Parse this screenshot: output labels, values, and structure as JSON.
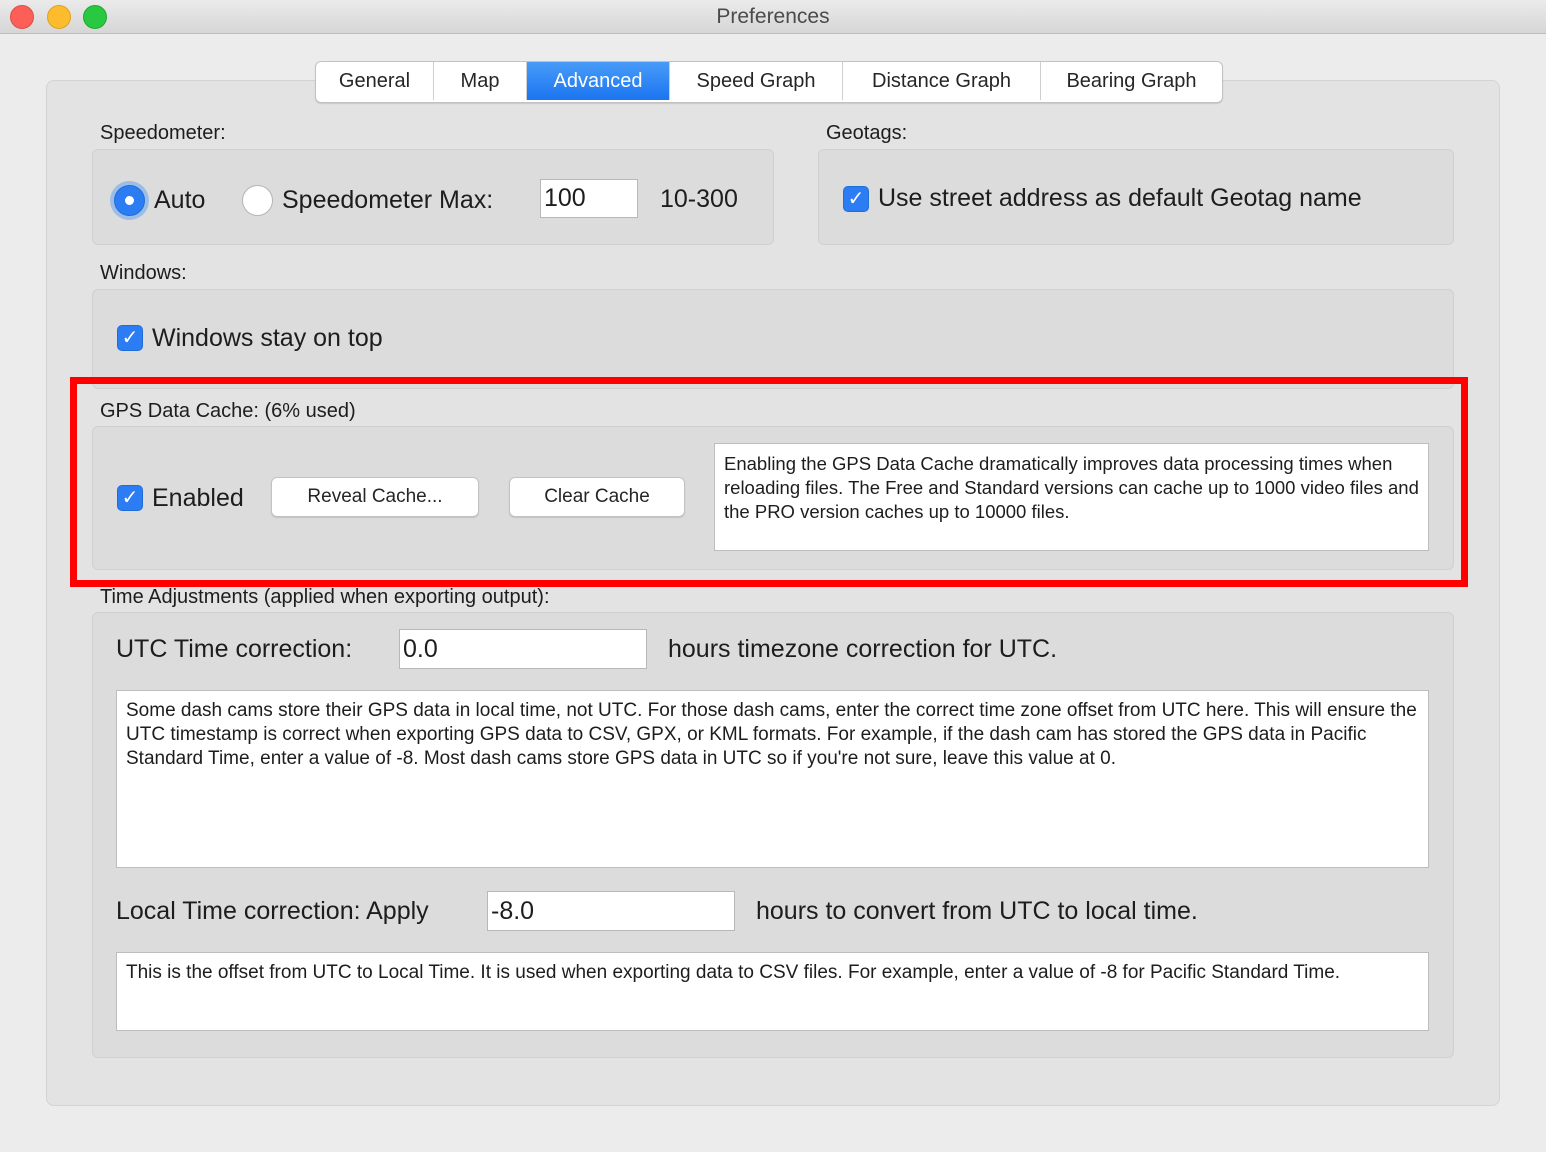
{
  "window": {
    "title": "Preferences"
  },
  "tabs": [
    {
      "label": "General",
      "active": false
    },
    {
      "label": "Map",
      "active": false
    },
    {
      "label": "Advanced",
      "active": true
    },
    {
      "label": "Speed Graph",
      "active": false
    },
    {
      "label": "Distance Graph",
      "active": false
    },
    {
      "label": "Bearing Graph",
      "active": false
    }
  ],
  "speedometer": {
    "section_label": "Speedometer:",
    "auto_label": "Auto",
    "auto_selected": true,
    "max_label": "Speedometer Max:",
    "max_value": "100",
    "range_label": "10-300"
  },
  "geotags": {
    "section_label": "Geotags:",
    "street_address_label": "Use street address as default Geotag name",
    "street_address_checked": true
  },
  "windows": {
    "section_label": "Windows:",
    "stay_on_top_label": "Windows stay on top",
    "stay_on_top_checked": true
  },
  "gps_cache": {
    "section_label": "GPS Data Cache: (6% used)",
    "enabled_label": "Enabled",
    "enabled_checked": true,
    "reveal_button": "Reveal Cache...",
    "clear_button": "Clear Cache",
    "description": "Enabling the GPS Data Cache dramatically improves data processing times when reloading files. The Free and Standard versions can cache up to 1000 video files and the PRO version caches up to 10000 files."
  },
  "time_adjustments": {
    "section_label": "Time Adjustments (applied when exporting output):",
    "utc_label": "UTC Time correction:",
    "utc_value": "0.0",
    "utc_suffix": "hours timezone correction for UTC.",
    "utc_description": "Some dash cams store their GPS data in local time, not UTC. For those dash cams, enter the correct time zone offset from UTC here. This will ensure the UTC timestamp is correct when exporting GPS data to CSV, GPX, or KML formats. For example, if the dash cam has stored the GPS data in Pacific Standard Time, enter a value of -8. Most dash cams store GPS data in UTC so if you're not sure, leave this value at 0.",
    "local_label": "Local Time correction: Apply",
    "local_value": "-8.0",
    "local_suffix": "hours to convert from UTC to local time.",
    "local_description": "This is the offset from UTC to Local Time. It is used when exporting data to CSV files. For example, enter a value of -8 for Pacific Standard Time."
  },
  "colors": {
    "accent": "#2c7df4",
    "highlight": "#ff0000"
  }
}
